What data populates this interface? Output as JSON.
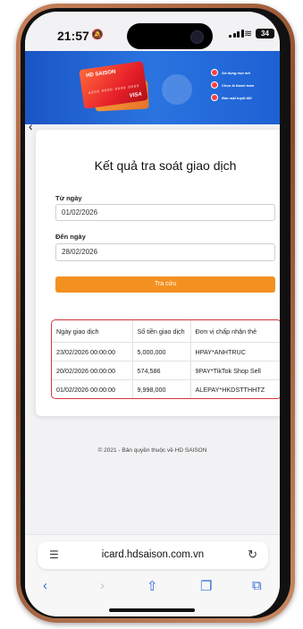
{
  "status_bar": {
    "time": "21:57",
    "battery": "34",
    "icons": [
      "do-not-disturb-icon",
      "signal-icon",
      "wifi-icon",
      "battery-icon"
    ]
  },
  "banner": {
    "card_brand": "HD SAISON",
    "card_network": "VISA",
    "card_number": "4200 0000 0000 0000",
    "bullets": [
      "Sử dụng mọi nơi",
      "Chọn là thanh toán",
      "Bảo mật tuyệt đối"
    ]
  },
  "page": {
    "title": "Kết quả tra soát giao dịch",
    "from_label": "Từ ngày",
    "from_value": "01/02/2026",
    "to_label": "Đến ngày",
    "to_value": "28/02/2026",
    "search_button": "Tra cứu"
  },
  "table": {
    "headers": [
      "Ngày giao dịch",
      "Số tiền giao dịch",
      "Đơn vị chấp nhận thẻ"
    ],
    "rows": [
      [
        "23/02/2026 00:00:00",
        "5,000,000",
        "HPAY*ANHTRUC"
      ],
      [
        "20/02/2026 00:00:00",
        "574,586",
        "9PAY*TikTok Shop Sell"
      ],
      [
        "01/02/2026 00:00:00",
        "9,998,000",
        "ALEPAY*HKDSTTHHTZ"
      ]
    ]
  },
  "footer": {
    "copyright": "© 2021 - Bản quyền thuộc về HD SAISON"
  },
  "browser": {
    "url": "icard.hdsaison.com.vn",
    "toolbar_icons": [
      "back-icon",
      "forward-icon",
      "share-icon",
      "bookmarks-icon",
      "tabs-icon"
    ]
  },
  "colors": {
    "accent": "#f39120",
    "table_border": "#d4363c",
    "banner": "#1e60d4",
    "safari_blue": "#2d6ad6"
  }
}
